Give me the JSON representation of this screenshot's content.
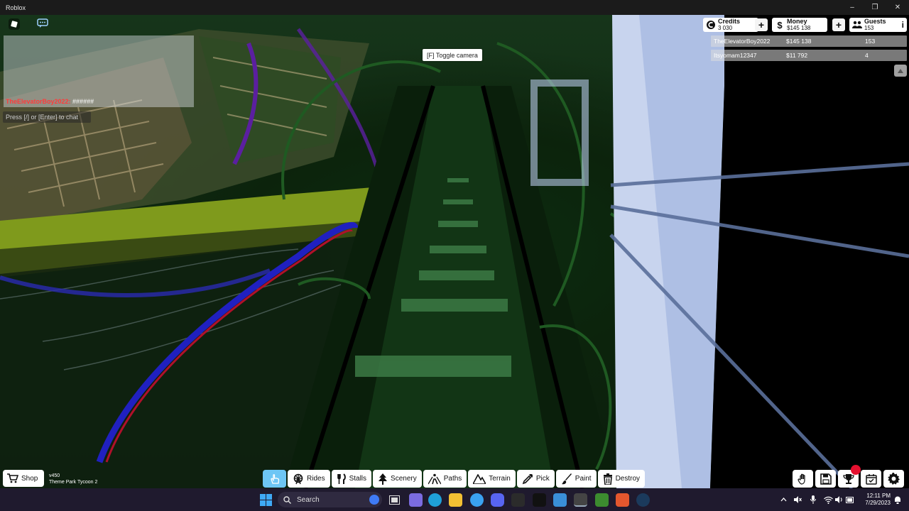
{
  "window": {
    "title": "Roblox",
    "controls": {
      "minimize": "–",
      "maximize": "❐",
      "close": "✕"
    }
  },
  "chat": {
    "username": "TheElevatorBoy2022:",
    "message": " ######",
    "input_placeholder": "Press [/] or [Enter] to chat"
  },
  "hint": {
    "toggle_camera": "[F] Toggle camera"
  },
  "stats": {
    "credits": {
      "label": "Credits",
      "value": "3 030",
      "icon": "credits-icon"
    },
    "money": {
      "label": "Money",
      "value": "$145 138",
      "icon": "dollar-icon"
    },
    "guests": {
      "label": "Guests",
      "value": "153",
      "icon": "guests-icon"
    }
  },
  "leaderboard": [
    {
      "name": "TheElevatorBoy2022",
      "money": "$145 138",
      "guests": "153"
    },
    {
      "name": "Itsyomam12347",
      "money": "$11 792",
      "guests": "4"
    }
  ],
  "hud": {
    "shop_label": "Shop",
    "version": "v450",
    "game_name": "Theme Park Tycoon 2",
    "accent_color": "#6ec6f5"
  },
  "toolbar": [
    {
      "id": "rides",
      "label": "Rides",
      "icon": "ferris-wheel-icon"
    },
    {
      "id": "stalls",
      "label": "Stalls",
      "icon": "fork-knife-icon"
    },
    {
      "id": "scenery",
      "label": "Scenery",
      "icon": "tree-icon"
    },
    {
      "id": "paths",
      "label": "Paths",
      "icon": "path-icon"
    },
    {
      "id": "terrain",
      "label": "Terrain",
      "icon": "mountain-icon"
    },
    {
      "id": "pick",
      "label": "Pick",
      "icon": "eyedropper-icon"
    },
    {
      "id": "paint",
      "label": "Paint",
      "icon": "brush-icon"
    },
    {
      "id": "destroy",
      "label": "Destroy",
      "icon": "trash-icon"
    }
  ],
  "taskbar": {
    "search_placeholder": "Search",
    "time": "12:11 PM",
    "date": "7/29/2023"
  }
}
